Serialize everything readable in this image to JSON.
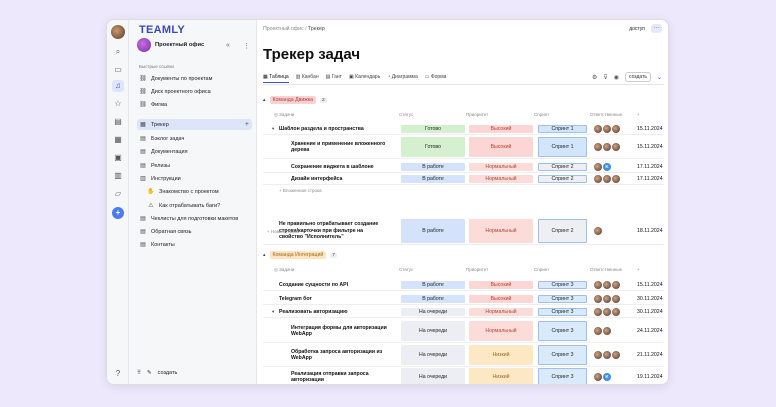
{
  "brand": "TEAMLY",
  "workspace": {
    "name": "Проектный офис",
    "collapse": "«",
    "more": "⋮"
  },
  "sidebar": {
    "quick_links_label": "Быстрые ссылки",
    "items": [
      {
        "icon": "link",
        "label": "Документы по проектам"
      },
      {
        "icon": "link",
        "label": "Диск проектного офиса"
      },
      {
        "icon": "link",
        "label": "Фигма"
      },
      {
        "icon": "table",
        "label": "Трекер",
        "active": true
      },
      {
        "icon": "doc",
        "label": "Бэклог задач"
      },
      {
        "icon": "doc",
        "label": "Документация"
      },
      {
        "icon": "doc",
        "label": "Релизы"
      },
      {
        "icon": "book",
        "label": "Инструкции"
      },
      {
        "icon": "hand",
        "label": "Знакомство с проектом"
      },
      {
        "icon": "warn",
        "label": "Как отрабатывать баги?"
      },
      {
        "icon": "doc",
        "label": "Чеклисты для подготовки макетов"
      },
      {
        "icon": "doc",
        "label": "Обратная связь"
      },
      {
        "icon": "doc",
        "label": "Контакты"
      }
    ],
    "add": "+",
    "create_label": "создать"
  },
  "breadcrumb": {
    "parent": "Проектный офис",
    "sep": "/",
    "current": "Трекер"
  },
  "access_label": "доступ",
  "page_title": "Трекер задач",
  "views": [
    "Таблица",
    "Канбан",
    "Гант",
    "Календарь",
    "Диаграмма",
    "Форма"
  ],
  "create_button": "создать",
  "columns": {
    "task": "Задачи",
    "status": "Статус",
    "priority": "Приоритет",
    "sprint": "Спринт",
    "owner": "Ответственные"
  },
  "groups": [
    {
      "name": "Команда Движка",
      "count": "2",
      "rows": [
        {
          "name": "Шаблон раздела и пространства",
          "status": "Готово",
          "priority": "Высокий",
          "sprint": "Спринт 1",
          "date": "15.11.2024"
        },
        {
          "name": "Хранение и применение вложенного дерева",
          "status": "Готово",
          "priority": "Высокий",
          "sprint": "Спринт 1",
          "date": "15.11.2024"
        },
        {
          "name": "Сохранение виджета в шаблоне",
          "status": "В работе",
          "priority": "Нормальный",
          "sprint": "Спринт 2",
          "date": "17.11.2024"
        },
        {
          "name": "Дизайн интерфейса",
          "status": "В работе",
          "priority": "Нормальный",
          "sprint": "Спринт 2",
          "date": "17.11.2024"
        },
        {
          "name": "Не правильно отрабатывает создание строки/карточки при фильтре на свойство \"Исполнитель\"",
          "status": "В работе",
          "priority": "Нормальный",
          "sprint": "Спринт 2",
          "date": "18.11.2024"
        }
      ],
      "nested_row_label": "Вложенная строка",
      "new_row_label": "Новая строка"
    },
    {
      "name": "Команда Интеграций",
      "count": "7",
      "rows": [
        {
          "name": "Создание сущности по API",
          "status": "В работе",
          "priority": "Высокий",
          "sprint": "Спринт 3",
          "date": "15.11.2024"
        },
        {
          "name": "Telegram бот",
          "status": "В работе",
          "priority": "Высокий",
          "sprint": "Спринт 3",
          "date": "30.11.2024"
        },
        {
          "name": "Реализовать авторизацию",
          "status": "На очереди",
          "priority": "Нормальный",
          "sprint": "Спринт 3",
          "date": "30.11.2024"
        },
        {
          "name": "Интеграция формы для авторизации WebApp",
          "status": "На очереди",
          "priority": "Нормальный",
          "sprint": "Спринт 3",
          "date": "24.11.2024"
        },
        {
          "name": "Обработка запроса авторизации из WebApp",
          "status": "На очереди",
          "priority": "Низкий",
          "sprint": "Спринт 3",
          "date": "21.11.2024"
        },
        {
          "name": "Реализация отправки запроса авторизации",
          "status": "На очереди",
          "priority": "Низкий",
          "sprint": "Спринт 3",
          "date": "19.11.2024"
        }
      ]
    }
  ],
  "colors": {
    "Готово": "#d4f0cf",
    "В работе": "#d4e3fb",
    "На очереди": "#eceef3",
    "Высокий": "#fbd6d4",
    "Нормальный": "#fbdcd8",
    "Низкий": "#fde8c6",
    "sprint1": "#d2e6fb",
    "sprint2": "#eeeff2",
    "sprint3": "#d9eafb",
    "group1": "#fbd2d2",
    "group2": "#fde5c2"
  }
}
